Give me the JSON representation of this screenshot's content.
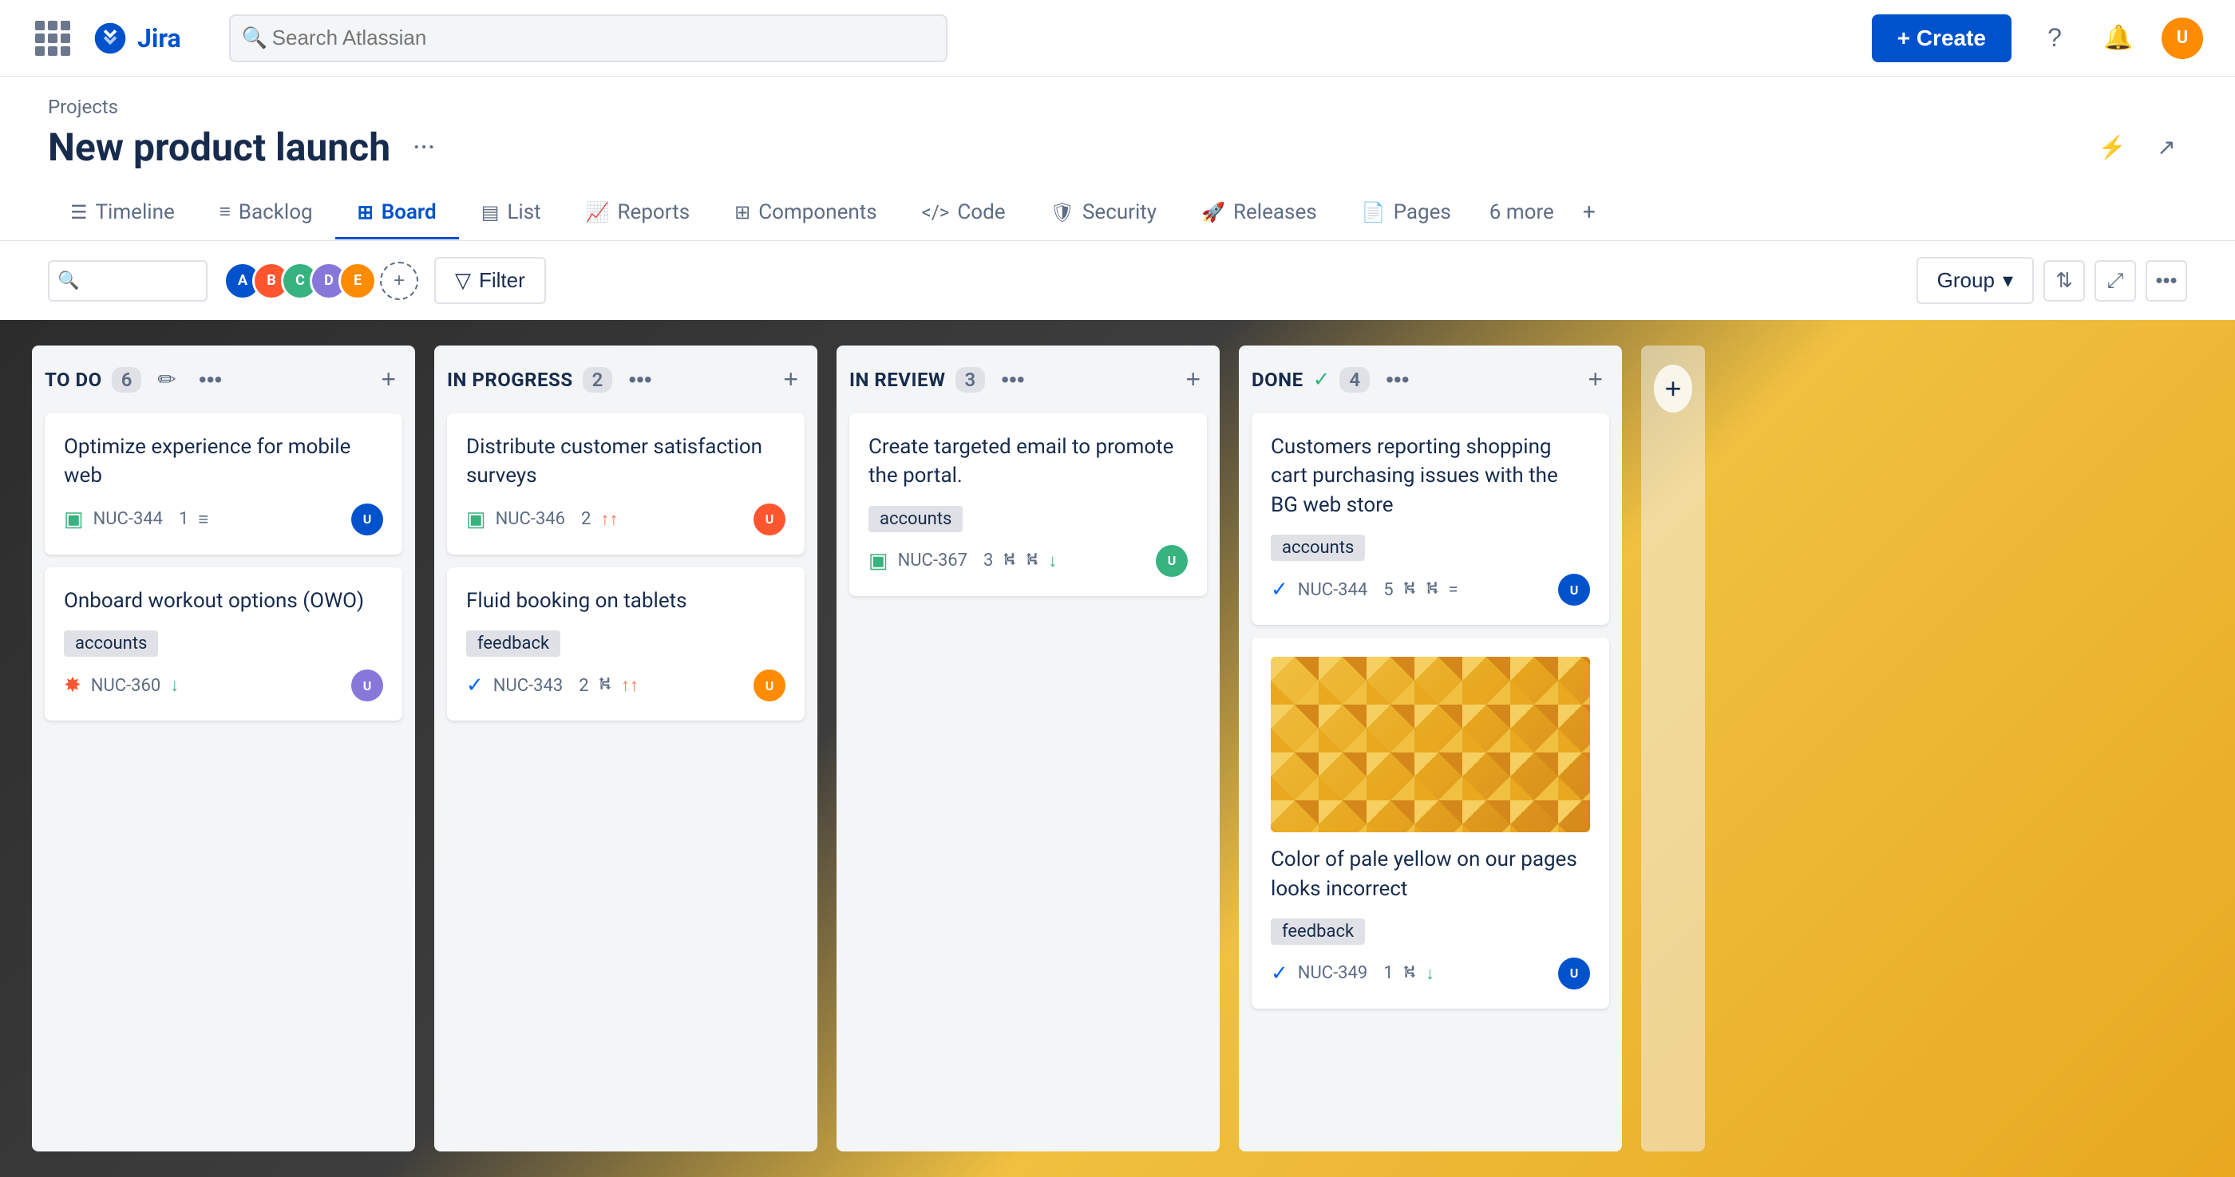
{
  "app": {
    "name": "Jira",
    "search_placeholder": "Search Atlassian"
  },
  "topnav": {
    "create_label": "+ Create",
    "help_icon": "?",
    "notification_icon": "🔔",
    "avatar_initials": "U"
  },
  "project": {
    "breadcrumb": "Projects",
    "title": "New product launch",
    "more_icon": "···"
  },
  "tabs": [
    {
      "id": "timeline",
      "label": "Timeline",
      "icon": "☰",
      "active": false
    },
    {
      "id": "backlog",
      "label": "Backlog",
      "icon": "≡",
      "active": false
    },
    {
      "id": "board",
      "label": "Board",
      "icon": "⊞",
      "active": true
    },
    {
      "id": "list",
      "label": "List",
      "icon": "▤",
      "active": false
    },
    {
      "id": "reports",
      "label": "Reports",
      "icon": "📈",
      "active": false
    },
    {
      "id": "components",
      "label": "Components",
      "icon": "⊞",
      "active": false
    },
    {
      "id": "code",
      "label": "Code",
      "icon": "</>",
      "active": false
    },
    {
      "id": "security",
      "label": "Security",
      "icon": "🛡",
      "active": false
    },
    {
      "id": "releases",
      "label": "Releases",
      "icon": "🚀",
      "active": false
    },
    {
      "id": "pages",
      "label": "Pages",
      "icon": "📄",
      "active": false
    },
    {
      "id": "more",
      "label": "6 more",
      "active": false
    }
  ],
  "toolbar": {
    "filter_label": "Filter",
    "group_label": "Group",
    "search_placeholder": ""
  },
  "board": {
    "columns": [
      {
        "id": "todo",
        "title": "TO DO",
        "count": "6",
        "done": false,
        "cards": [
          {
            "id": "card-todo-1",
            "title": "Optimize experience for mobile web",
            "tag": null,
            "issue_type": "story",
            "issue_icon": "▣",
            "issue_id": "NUC-344",
            "count": "1",
            "has_branch": true,
            "priority": "medium",
            "avatar_color": "#0052cc",
            "avatar_initials": "U"
          },
          {
            "id": "card-todo-2",
            "title": "Onboard workout options (OWO)",
            "tag": "accounts",
            "issue_type": "bug",
            "issue_icon": "✸",
            "issue_id": "NUC-360",
            "count": null,
            "has_branch": false,
            "priority": "low",
            "avatar_color": "#8777d9",
            "avatar_initials": "U"
          }
        ]
      },
      {
        "id": "in-progress",
        "title": "IN PROGRESS",
        "count": "2",
        "done": false,
        "cards": [
          {
            "id": "card-progress-1",
            "title": "Distribute customer satisfaction surveys",
            "tag": null,
            "issue_type": "story",
            "issue_icon": "▣",
            "issue_id": "NUC-346",
            "count": "2",
            "has_branch": false,
            "priority": "high",
            "avatar_color": "#ff5630",
            "avatar_initials": "U"
          },
          {
            "id": "card-progress-2",
            "title": "Fluid booking on tablets",
            "tag": "feedback",
            "issue_type": "task",
            "issue_icon": "✓",
            "issue_id": "NUC-343",
            "count": "2",
            "has_branch": true,
            "priority": "high",
            "avatar_color": "#ff8b00",
            "avatar_initials": "U"
          }
        ]
      },
      {
        "id": "in-review",
        "title": "IN REVIEW",
        "count": "3",
        "done": false,
        "cards": [
          {
            "id": "card-review-1",
            "title": "Create targeted email to promote the portal.",
            "tag": "accounts",
            "issue_type": "story",
            "issue_icon": "▣",
            "issue_id": "NUC-367",
            "count": "3",
            "has_branch": true,
            "priority": "low",
            "avatar_color": "#36b37e",
            "avatar_initials": "U"
          }
        ]
      },
      {
        "id": "done",
        "title": "DONE",
        "count": "4",
        "done": true,
        "cards": [
          {
            "id": "card-done-1",
            "title": "Customers reporting shopping cart purchasing issues with the BG web store",
            "tag": "accounts",
            "issue_type": "task",
            "issue_icon": "✓",
            "issue_id": "NUC-344",
            "count": "5",
            "has_branch": true,
            "priority": "medium",
            "avatar_color": "#0052cc",
            "avatar_initials": "U"
          },
          {
            "id": "card-done-2",
            "title": "Color of pale yellow on our pages looks incorrect",
            "tag": "feedback",
            "issue_type": "task",
            "issue_icon": "✓",
            "issue_id": "NUC-349",
            "count": "1",
            "has_branch": true,
            "priority": "low",
            "avatar_color": "#0052cc",
            "avatar_initials": "U",
            "has_image": true
          }
        ]
      }
    ]
  },
  "avatars": [
    {
      "color": "#0052cc",
      "initials": "A"
    },
    {
      "color": "#ff5630",
      "initials": "B"
    },
    {
      "color": "#36b37e",
      "initials": "C"
    },
    {
      "color": "#8777d9",
      "initials": "D"
    },
    {
      "color": "#ff8b00",
      "initials": "E"
    }
  ]
}
